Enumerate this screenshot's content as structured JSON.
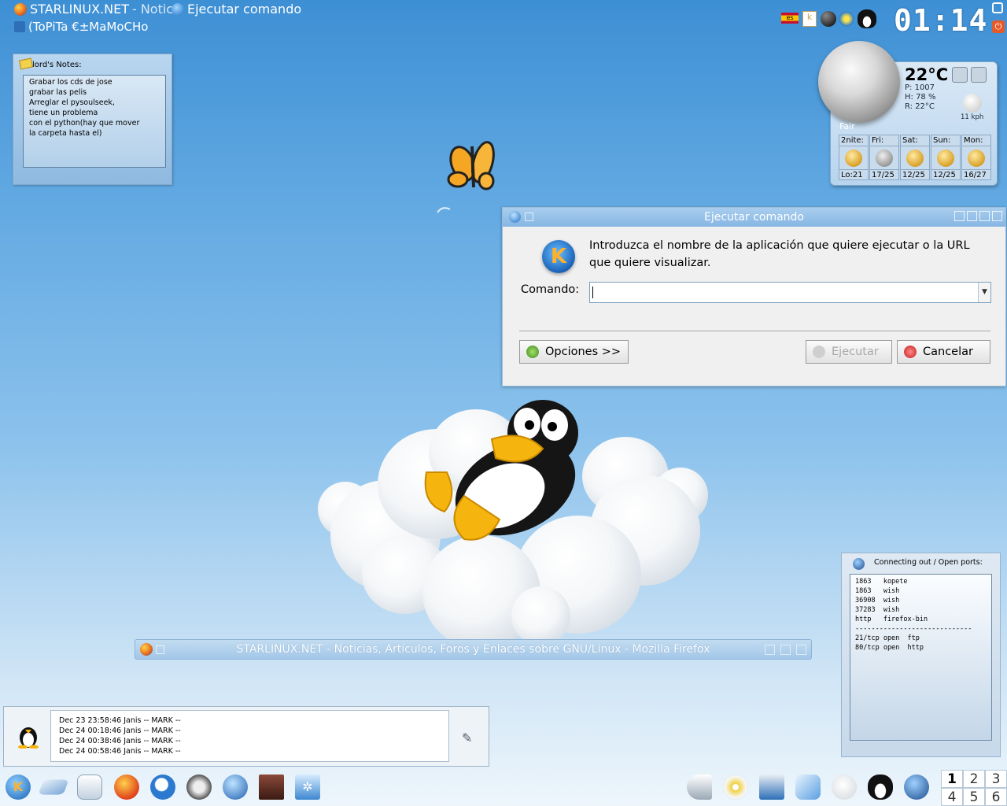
{
  "taskbar": {
    "items": [
      {
        "label": "STARLINUX.NET",
        "suffix": "- Notici",
        "icon": "firefox-icon"
      },
      {
        "label": "Ejecutar comando",
        "icon": "run-icon"
      }
    ],
    "user_line": "(ToPiTa   €±MaMoCHo"
  },
  "systray": {
    "clock": "01:14",
    "locale": "es"
  },
  "notes": {
    "title": "lord's Notes:",
    "lines": [
      "Grabar los cds de jose",
      "grabar las pelis",
      "Arreglar el pysoulseek,",
      "tiene un problema",
      "con el python(hay que mover",
      "la carpeta hasta el)"
    ]
  },
  "weather": {
    "temperature": "22°C",
    "pressure": "P: 1007",
    "humidity": "H: 78 %",
    "real": "R: 22°C",
    "wind": "11 kph",
    "condition": "Fair",
    "forecast": [
      {
        "day": "2nite:",
        "temps": "Lo:21"
      },
      {
        "day": "Fri:",
        "temps": "17/25"
      },
      {
        "day": "Sat:",
        "temps": "12/25"
      },
      {
        "day": "Sun:",
        "temps": "12/25"
      },
      {
        "day": "Mon:",
        "temps": "16/27"
      }
    ]
  },
  "run_dialog": {
    "title": "Ejecutar comando",
    "prompt": "Introduzca el nombre de la aplicación que quiere ejecutar o la URL que quiere visualizar.",
    "command_label": "Comando:",
    "command_value": "",
    "options_button": "Opciones >>",
    "run_button": "Ejecutar",
    "cancel_button": "Cancelar"
  },
  "firefox_window": {
    "title": "STARLINUX.NET - Noticias, Artículos, Foros y Enlaces sobre GNU/Linux - Mozilla Firefox"
  },
  "log_panel": {
    "lines": [
      "Dec 23 23:58:46 Janis -- MARK --",
      "Dec 24 00:18:46 Janis -- MARK --",
      "Dec 24 00:38:46 Janis -- MARK --",
      "Dec 24 00:58:46 Janis -- MARK --"
    ]
  },
  "ports_panel": {
    "title": "Connecting out / Open ports:",
    "text": "1863   kopete\n1863   wish\n36908  wish\n37283  wish\nhttp   firefox-bin\n-----------------------------\n21/tcp open  ftp\n80/tcp open  http"
  },
  "pager": {
    "desktops": [
      "1",
      "2",
      "3",
      "4",
      "5",
      "6"
    ],
    "active": "1"
  },
  "colors": {
    "desktop_top": "#3d8fd4",
    "desktop_bottom": "#eef6fc",
    "dialog_title": "#86b6e3"
  }
}
